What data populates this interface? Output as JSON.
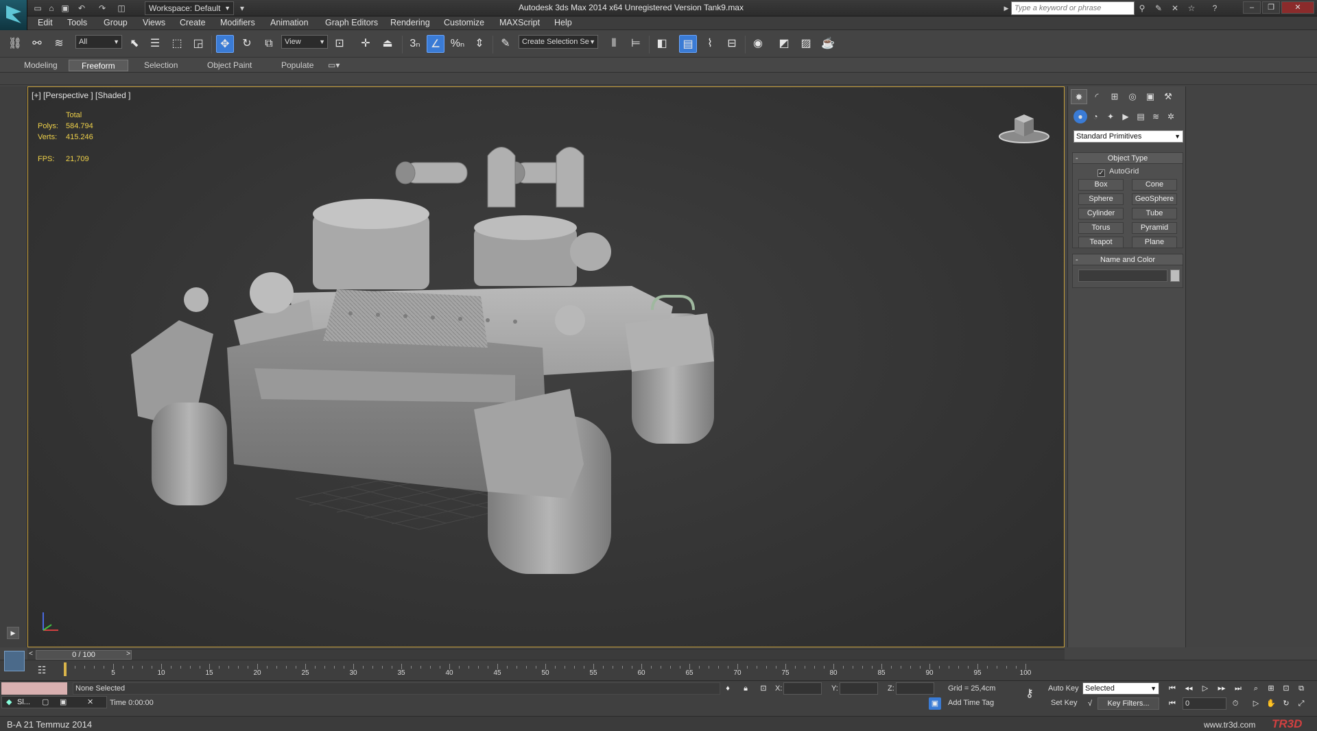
{
  "titlebar": {
    "workspace": "Workspace: Default",
    "title": "Autodesk 3ds Max  2014 x64    Unregistered Version     Tank9.max",
    "search_placeholder": "Type a keyword or phrase"
  },
  "menu": [
    "Edit",
    "Tools",
    "Group",
    "Views",
    "Create",
    "Modifiers",
    "Animation",
    "Graph Editors",
    "Rendering",
    "Customize",
    "MAXScript",
    "Help"
  ],
  "toolbar": {
    "selection_filter": "All",
    "ref_coord": "View",
    "named_selection_placeholder": "Create Selection Se"
  },
  "ribbon": {
    "tabs": [
      "Modeling",
      "Freeform",
      "Selection",
      "Object Paint",
      "Populate"
    ],
    "active_tab": "Freeform"
  },
  "viewport": {
    "label": "[+] [Perspective ] [Shaded ]",
    "stats_header": "Total",
    "polys_label": "Polys:",
    "polys_value": "584.794",
    "verts_label": "Verts:",
    "verts_value": "415.246",
    "fps_label": "FPS:",
    "fps_value": "21,709"
  },
  "command_panel": {
    "category": "Standard Primitives",
    "object_type_title": "Object Type",
    "autogrid_label": "AutoGrid",
    "autogrid_checked": true,
    "primitives": [
      "Box",
      "Cone",
      "Sphere",
      "GeoSphere",
      "Cylinder",
      "Tube",
      "Torus",
      "Pyramid",
      "Teapot",
      "Plane"
    ],
    "name_color_title": "Name and Color"
  },
  "timeline": {
    "frame_display": "0 / 100",
    "ticks": [
      "5",
      "10",
      "15",
      "20",
      "25",
      "30",
      "35",
      "40",
      "45",
      "50",
      "55",
      "60",
      "65",
      "70",
      "75",
      "80",
      "85",
      "90",
      "95",
      "100"
    ]
  },
  "status": {
    "selection": "None Selected",
    "x_label": "X:",
    "y_label": "Y:",
    "z_label": "Z:",
    "grid": "Grid = 25,4cm",
    "auto_key": "Auto Key",
    "auto_key_mode": "Selected",
    "set_key": "Set Key",
    "key_filters": "Key Filters...",
    "frame": "0",
    "time": "Time  0:00:00",
    "add_time_tag": "Add Time Tag",
    "mini_listener": "Sl..."
  },
  "footer": {
    "left": "B-A 21 Temmuz 2014",
    "right": "www.tr3d.com",
    "logo_tr": "TR",
    "logo_3d": "3D"
  }
}
